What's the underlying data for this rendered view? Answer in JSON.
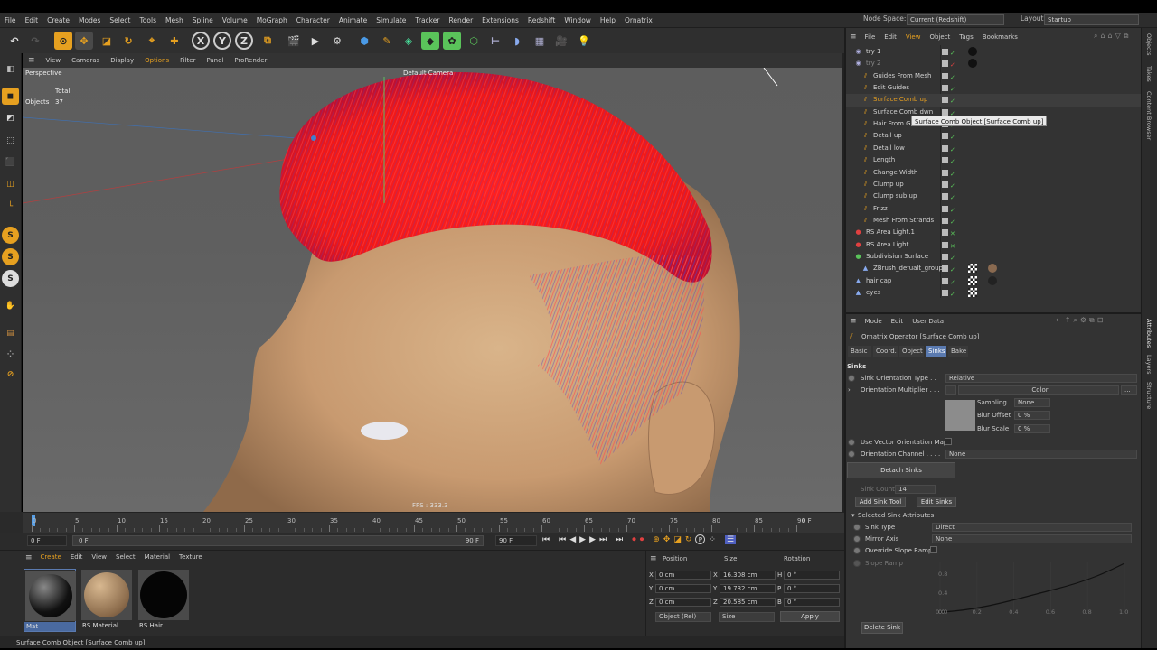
{
  "menubar": {
    "items": [
      "File",
      "Edit",
      "Create",
      "Modes",
      "Select",
      "Tools",
      "Mesh",
      "Spline",
      "Volume",
      "MoGraph",
      "Character",
      "Animate",
      "Simulate",
      "Tracker",
      "Render",
      "Extensions",
      "Redshift",
      "Window",
      "Help",
      "Ornatrix"
    ],
    "node_space_label": "Node Space:",
    "node_space_value": "Current (Redshift)",
    "layout_label": "Layout:",
    "layout_value": "Startup"
  },
  "toolbar": {
    "axis_x": "X",
    "axis_y": "Y",
    "axis_z": "Z"
  },
  "viewport": {
    "menu": [
      "View",
      "Cameras",
      "Display",
      "Options",
      "Filter",
      "Panel",
      "ProRender"
    ],
    "projection": "Perspective",
    "camera": "Default Camera",
    "stats_total": "Total",
    "stats_objects_label": "Objects",
    "stats_objects_value": "37",
    "fps": "FPS : 333.3",
    "left_tools": [
      "S",
      "S",
      "S"
    ]
  },
  "timeline": {
    "ticks": [
      "0",
      "5",
      "10",
      "15",
      "20",
      "25",
      "30",
      "35",
      "40",
      "45",
      "50",
      "55",
      "60",
      "65",
      "70",
      "75",
      "80",
      "85",
      "90"
    ],
    "current_frame": "0 F",
    "start_field": "0 F",
    "range_start": "0 F",
    "range_end": "90 F",
    "end_field": "90 F",
    "p_key": "P"
  },
  "materials": {
    "menu": [
      "Create",
      "Edit",
      "View",
      "Select",
      "Material",
      "Texture"
    ],
    "items": [
      {
        "name": "Mat"
      },
      {
        "name": "RS Material"
      },
      {
        "name": "RS Hair"
      }
    ]
  },
  "coordinates": {
    "headers": [
      "Position",
      "Size",
      "Rotation"
    ],
    "rows": [
      {
        "axis": "X",
        "pos": "0 cm",
        "size_axis": "X",
        "size": "16.308 cm",
        "rot_axis": "H",
        "rot": "0 °"
      },
      {
        "axis": "Y",
        "pos": "0 cm",
        "size_axis": "Y",
        "size": "19.732 cm",
        "rot_axis": "P",
        "rot": "0 °"
      },
      {
        "axis": "Z",
        "pos": "0 cm",
        "size_axis": "Z",
        "size": "20.585 cm",
        "rot_axis": "B",
        "rot": "0 °"
      }
    ],
    "mode_select": "Object (Rel)",
    "size_select": "Size",
    "apply": "Apply"
  },
  "status": "Surface Comb Object [Surface Comb up]",
  "object_manager": {
    "menu": [
      "File",
      "Edit",
      "View",
      "Object",
      "Tags",
      "Bookmarks"
    ],
    "rows": [
      {
        "name": "try 1",
        "color": "#d2d2d2"
      },
      {
        "name": "try 2",
        "color": "#888888"
      },
      {
        "name": "Guides From Mesh",
        "color": "#d2d2d2"
      },
      {
        "name": "Edit Guides",
        "color": "#d2d2d2"
      },
      {
        "name": "Surface Comb up",
        "color": "#e8a020"
      },
      {
        "name": "Surface Comb dwn",
        "color": "#d2d2d2"
      },
      {
        "name": "Hair From G",
        "color": "#d2d2d2"
      },
      {
        "name": "Detail up",
        "color": "#d2d2d2"
      },
      {
        "name": "Detail low",
        "color": "#d2d2d2"
      },
      {
        "name": "Length",
        "color": "#d2d2d2"
      },
      {
        "name": "Change Width",
        "color": "#d2d2d2"
      },
      {
        "name": "Clump up",
        "color": "#d2d2d2"
      },
      {
        "name": "Clump sub up",
        "color": "#d2d2d2"
      },
      {
        "name": "Frizz",
        "color": "#d2d2d2"
      },
      {
        "name": "Mesh From Strands",
        "color": "#d2d2d2"
      },
      {
        "name": "RS Area Light.1",
        "color": "#d2d2d2"
      },
      {
        "name": "RS Area Light",
        "color": "#d2d2d2"
      },
      {
        "name": "Subdivision Surface",
        "color": "#d2d2d2"
      },
      {
        "name": "ZBrush_defualt_group",
        "color": "#d2d2d2"
      },
      {
        "name": "hair cap",
        "color": "#d2d2d2"
      },
      {
        "name": "eyes",
        "color": "#d2d2d2"
      }
    ],
    "tooltip": "Surface Comb Object [Surface Comb up]"
  },
  "attributes": {
    "menu": [
      "Mode",
      "Edit",
      "User Data"
    ],
    "title": "Ornatrix Operator [Surface Comb up]",
    "tabs": [
      "Basic",
      "Coord.",
      "Object",
      "Sinks",
      "Bake"
    ],
    "active_tab": "Sinks",
    "section": "Sinks",
    "sink_orientation_type_label": "Sink Orientation Type . .",
    "sink_orientation_type_value": "Relative",
    "orientation_multiplier_label": "Orientation Multiplier . . .",
    "color_label": "Color",
    "sampling_label": "Sampling",
    "sampling_value": "None",
    "blur_offset_label": "Blur Offset",
    "blur_offset_value": "0 %",
    "blur_scale_label": "Blur Scale",
    "blur_scale_value": "0 %",
    "use_vector_map_label": "Use Vector Orientation Map",
    "orientation_channel_label": "Orientation Channel . . . .",
    "orientation_channel_value": "None",
    "detach_sinks": "Detach Sinks",
    "sink_count_label": "Sink Count",
    "sink_count_value": "14",
    "add_sink_tool": "Add Sink Tool",
    "edit_sinks": "Edit Sinks",
    "selected_section": "Selected Sink Attributes",
    "sink_type_label": "Sink Type",
    "sink_type_value": "Direct",
    "mirror_axis_label": "Mirror Axis",
    "mirror_axis_value": "None",
    "override_slope_label": "Override Slope Ramp",
    "slope_ramp_label": "Slope Ramp",
    "graph_y_ticks": [
      "0.8",
      "0.4",
      "0.0"
    ],
    "graph_x_ticks": [
      "0.0",
      "0.2",
      "0.4",
      "0.6",
      "0.8",
      "1.0"
    ],
    "delete_sink": "Delete Sink"
  },
  "right_tabs": [
    "Objects",
    "Takes",
    "Content Browser",
    "Attributes",
    "Layers",
    "Structure"
  ]
}
